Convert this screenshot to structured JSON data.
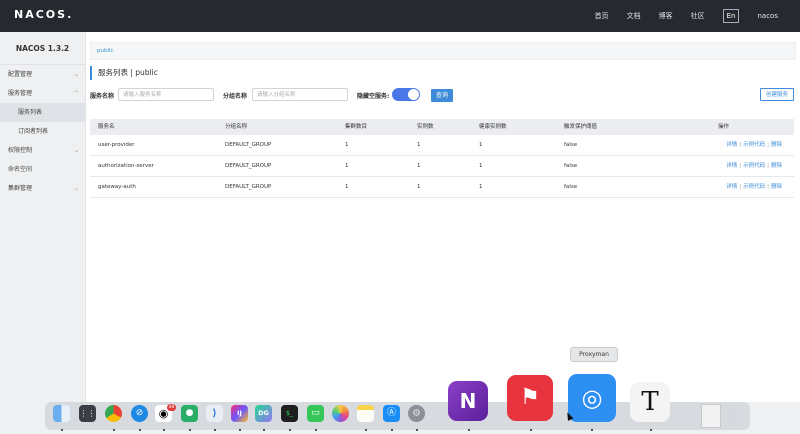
{
  "topbar": {
    "logo": "NACOS.",
    "nav": [
      "首页",
      "文档",
      "博客",
      "社区"
    ],
    "lang": "En",
    "user": "nacos"
  },
  "sidebar": {
    "version": "NACOS 1.3.2",
    "items": [
      {
        "label": "配置管理",
        "expandable": true
      },
      {
        "label": "服务管理",
        "expandable": true
      },
      {
        "label": "服务列表",
        "sub": true,
        "active": true
      },
      {
        "label": "订阅者列表",
        "sub": true
      },
      {
        "label": "权限控制",
        "expandable": true
      },
      {
        "label": "命名空间",
        "expandable": false
      },
      {
        "label": "集群管理",
        "expandable": true
      }
    ]
  },
  "main": {
    "namespace": "public",
    "title": "服务列表 | public",
    "filters": {
      "service_label": "服务名称",
      "service_placeholder": "请输入服务名称",
      "group_label": "分组名称",
      "group_placeholder": "请输入分组名称",
      "hide_empty_label": "隐藏空服务:",
      "hide_empty_on": true,
      "query_button": "查询",
      "create_button": "创建服务"
    },
    "table": {
      "headers": [
        "服务名",
        "分组名称",
        "集群数目",
        "实例数",
        "健康实例数",
        "触发保护阈值",
        "操作"
      ],
      "rows": [
        {
          "name": "user-provider",
          "group": "DEFAULT_GROUP",
          "clusters": "1",
          "instances": "1",
          "healthy": "1",
          "protect": "false"
        },
        {
          "name": "authorization-server",
          "group": "DEFAULT_GROUP",
          "clusters": "1",
          "instances": "1",
          "healthy": "1",
          "protect": "false"
        },
        {
          "name": "gateway-auth",
          "group": "DEFAULT_GROUP",
          "clusters": "1",
          "instances": "1",
          "healthy": "1",
          "protect": "false"
        }
      ],
      "ops": [
        "详情",
        "示例代码",
        "删除"
      ],
      "op_sep": "|"
    }
  },
  "dock": {
    "tooltip": "Proxyman",
    "qq_badge": "48",
    "icons": [
      "finder-icon",
      "launchpad-icon",
      "chrome-icon",
      "safari-icon",
      "qq-icon",
      "wechat-icon",
      "vscode-icon",
      "intellij-icon",
      "datagrip-icon",
      "terminal-icon",
      "messages-icon",
      "photos-icon",
      "notes-icon",
      "appstore-icon",
      "system-preferences-icon",
      "onenote-icon",
      "crash-app-icon",
      "proxyman-icon",
      "typora-icon",
      "document-icon",
      "trash-icon"
    ],
    "labels": {
      "intellij": "IJ",
      "datagrip": "DG",
      "terminal": "$_",
      "onenote": "N",
      "typora": "T"
    }
  }
}
